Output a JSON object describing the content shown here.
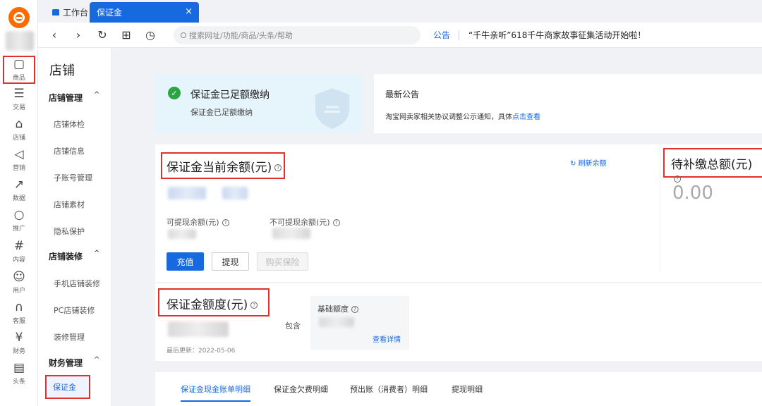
{
  "rail": {
    "items": [
      {
        "label": "商品",
        "icon": "bag-icon",
        "glyph": "▢"
      },
      {
        "label": "交易",
        "icon": "order-icon",
        "glyph": "☰"
      },
      {
        "label": "店铺",
        "icon": "store-icon",
        "glyph": "⌂"
      },
      {
        "label": "营销",
        "icon": "megaphone-icon",
        "glyph": "◁"
      },
      {
        "label": "数据",
        "icon": "chart-icon",
        "glyph": "↗"
      },
      {
        "label": "推广",
        "icon": "location-icon",
        "glyph": "○"
      },
      {
        "label": "内容",
        "icon": "hash-icon",
        "glyph": "#"
      },
      {
        "label": "用户",
        "icon": "user-icon",
        "glyph": "☺"
      },
      {
        "label": "客服",
        "icon": "headset-icon",
        "glyph": "∩"
      },
      {
        "label": "财务",
        "icon": "yen-icon",
        "glyph": "¥"
      },
      {
        "label": "头条",
        "icon": "news-icon",
        "glyph": "▤"
      }
    ]
  },
  "tabs": {
    "home_label": "工作台",
    "active_label": "保证金",
    "close_glyph": "×"
  },
  "toolbar": {
    "back": "‹",
    "forward": "›",
    "refresh": "↻",
    "new_tab": "⊞",
    "history": "◷",
    "search_placeholder": "搜索网址/功能/商品/头条/帮助",
    "announce_label": "公告",
    "announce_text": "“千牛亲听”618千牛商家故事征集活动开始啦！"
  },
  "subnav": {
    "title": "店铺",
    "groups": [
      {
        "label": "店铺管理",
        "caret": "^",
        "items": [
          "店铺体检",
          "店铺信息",
          "子账号管理",
          "店铺素材",
          "隐私保护"
        ]
      },
      {
        "label": "店铺装修",
        "caret": "^",
        "items": [
          "手机店铺装修",
          "PC店铺装修",
          "装修管理"
        ]
      },
      {
        "label": "财务管理",
        "caret": "^",
        "items": [
          "保证金"
        ]
      }
    ]
  },
  "status": {
    "title": "保证金已足额缴纳",
    "subtitle": "保证金已足额缴纳",
    "check_glyph": "✓"
  },
  "notice": {
    "title": "最新公告",
    "text": "淘宝网卖家相关协议调整公示通知，具体",
    "link": "点击查看"
  },
  "balance": {
    "title": "保证金当前余额(元)",
    "refresh_label": "刷新余额",
    "withdrawable_label": "可提现余额(元)",
    "non_withdrawable_label": "不可提现余额(元)",
    "recharge_btn": "充值",
    "withdraw_btn": "提现",
    "insurance_btn": "购买保险",
    "pending_title": "待补缴总额(元)",
    "pending_value": "0.00"
  },
  "quota": {
    "title": "保证金额度(元)",
    "contains_label": "包含",
    "basic_label": "基础额度",
    "detail_link": "查看详情",
    "updated": "最后更新：2022-05-06"
  },
  "detail_tabs": [
    "保证金现金账单明细",
    "保证金欠费明细",
    "预出账（消费者）明细",
    "提现明细"
  ],
  "help_glyph": "?"
}
